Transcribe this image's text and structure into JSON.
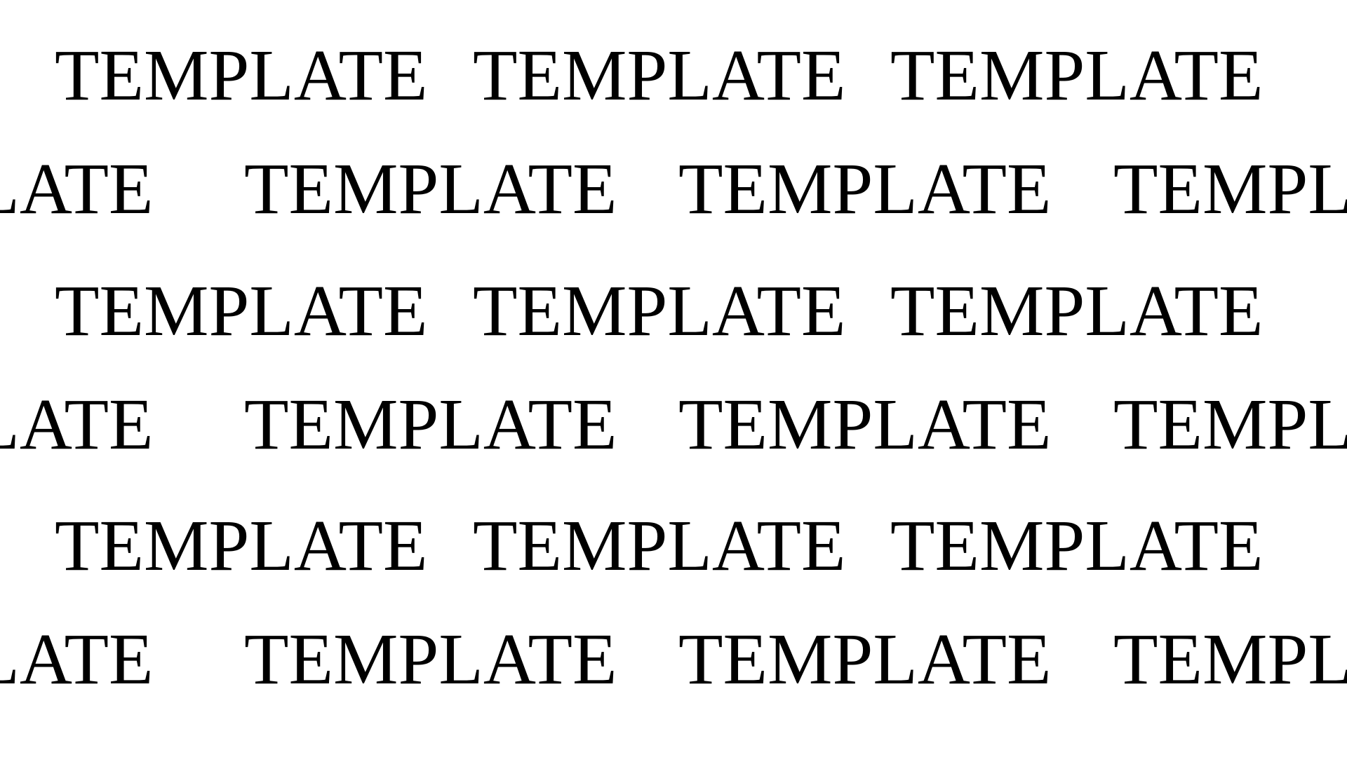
{
  "watermark": {
    "text": "TEMPLATE",
    "color": "#000000"
  }
}
